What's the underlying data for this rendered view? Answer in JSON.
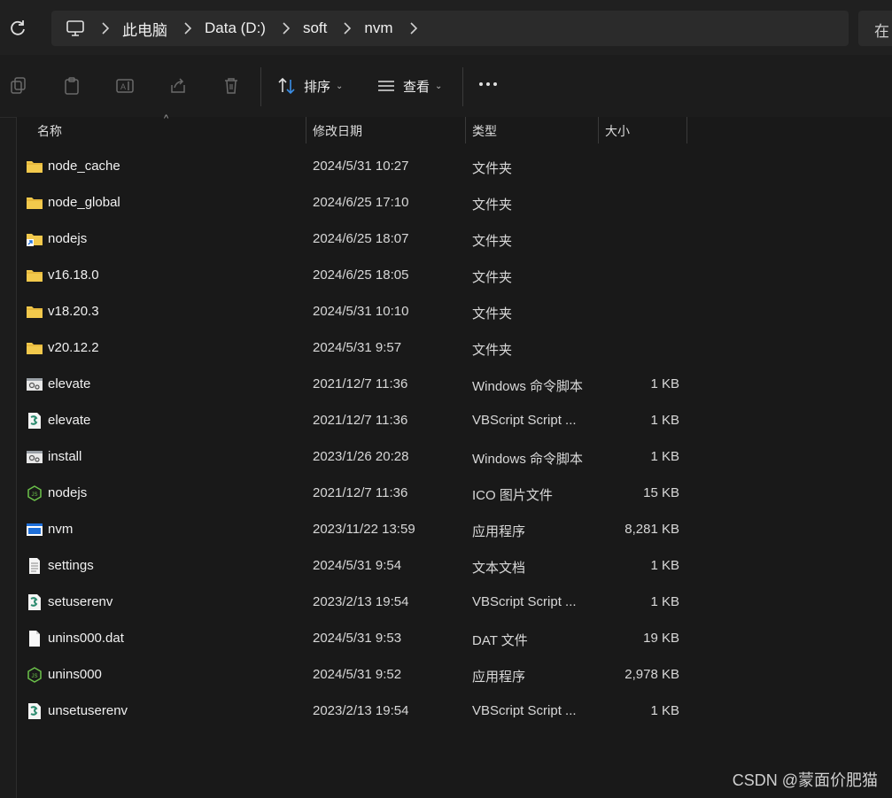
{
  "address": {
    "crumbs": [
      "此电脑",
      "Data (D:)",
      "soft",
      "nvm"
    ],
    "search_partial": "在"
  },
  "toolbar": {
    "sort_label": "排序",
    "view_label": "查看",
    "icons": [
      "copy-icon",
      "paste-icon",
      "rename-icon",
      "share-icon",
      "delete-icon",
      "sort-icon",
      "view-icon",
      "more-icon"
    ]
  },
  "columns": {
    "name": "名称",
    "date": "修改日期",
    "type": "类型",
    "size": "大小"
  },
  "files": [
    {
      "name": "node_cache",
      "date": "2024/5/31 10:27",
      "type": "文件夹",
      "size": "",
      "icon": "folder"
    },
    {
      "name": "node_global",
      "date": "2024/6/25 17:10",
      "type": "文件夹",
      "size": "",
      "icon": "folder"
    },
    {
      "name": "nodejs",
      "date": "2024/6/25 18:07",
      "type": "文件夹",
      "size": "",
      "icon": "folder-shortcut"
    },
    {
      "name": "v16.18.0",
      "date": "2024/6/25 18:05",
      "type": "文件夹",
      "size": "",
      "icon": "folder"
    },
    {
      "name": "v18.20.3",
      "date": "2024/5/31 10:10",
      "type": "文件夹",
      "size": "",
      "icon": "folder"
    },
    {
      "name": "v20.12.2",
      "date": "2024/5/31 9:57",
      "type": "文件夹",
      "size": "",
      "icon": "folder"
    },
    {
      "name": "elevate",
      "date": "2021/12/7 11:36",
      "type": "Windows 命令脚本",
      "size": "1 KB",
      "icon": "batch"
    },
    {
      "name": "elevate",
      "date": "2021/12/7 11:36",
      "type": "VBScript Script ...",
      "size": "1 KB",
      "icon": "vbscript"
    },
    {
      "name": "install",
      "date": "2023/1/26 20:28",
      "type": "Windows 命令脚本",
      "size": "1 KB",
      "icon": "batch"
    },
    {
      "name": "nodejs",
      "date": "2021/12/7 11:36",
      "type": "ICO 图片文件",
      "size": "15 KB",
      "icon": "nodejs"
    },
    {
      "name": "nvm",
      "date": "2023/11/22 13:59",
      "type": "应用程序",
      "size": "8,281 KB",
      "icon": "exe"
    },
    {
      "name": "settings",
      "date": "2024/5/31 9:54",
      "type": "文本文档",
      "size": "1 KB",
      "icon": "text"
    },
    {
      "name": "setuserenv",
      "date": "2023/2/13 19:54",
      "type": "VBScript Script ...",
      "size": "1 KB",
      "icon": "vbscript"
    },
    {
      "name": "unins000.dat",
      "date": "2024/5/31 9:53",
      "type": "DAT 文件",
      "size": "19 KB",
      "icon": "file"
    },
    {
      "name": "unins000",
      "date": "2024/5/31 9:52",
      "type": "应用程序",
      "size": "2,978 KB",
      "icon": "nodejs"
    },
    {
      "name": "unsetuserenv",
      "date": "2023/2/13 19:54",
      "type": "VBScript Script ...",
      "size": "1 KB",
      "icon": "vbscript"
    }
  ],
  "watermark": "CSDN @蒙面价肥猫",
  "colors": {
    "background": "#1c1c1c",
    "folder": "#f2c94c",
    "accent": "#3b8ee6"
  }
}
